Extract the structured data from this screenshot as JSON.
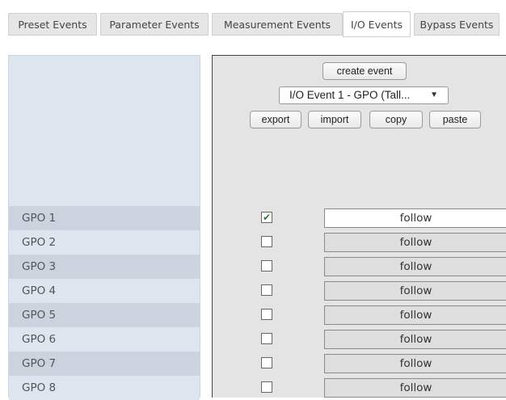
{
  "tabs": [
    {
      "label": "Preset Events",
      "active": false
    },
    {
      "label": "Parameter Events",
      "active": false
    },
    {
      "label": "Measurement Events",
      "active": false
    },
    {
      "label": "I/O Events",
      "active": true
    },
    {
      "label": "Bypass Events",
      "active": false
    }
  ],
  "toolbar": {
    "create_event": "create event",
    "event_select": "I/O Event 1 - GPO (Tall...",
    "export": "export",
    "import": "import",
    "copy": "copy",
    "paste": "paste"
  },
  "rows": [
    {
      "label": "GPO 1",
      "checked": true,
      "mode": "follow"
    },
    {
      "label": "GPO 2",
      "checked": false,
      "mode": "follow"
    },
    {
      "label": "GPO 3",
      "checked": false,
      "mode": "follow"
    },
    {
      "label": "GPO 4",
      "checked": false,
      "mode": "follow"
    },
    {
      "label": "GPO 5",
      "checked": false,
      "mode": "follow"
    },
    {
      "label": "GPO 6",
      "checked": false,
      "mode": "follow"
    },
    {
      "label": "GPO 7",
      "checked": false,
      "mode": "follow"
    },
    {
      "label": "GPO 8",
      "checked": false,
      "mode": "follow"
    }
  ],
  "colors": {
    "left_panel_bg": "#dde5ee",
    "left_row_dark": "#cbd4de",
    "right_panel_bg": "#e4e4e4",
    "check_color": "#2e7d32"
  }
}
